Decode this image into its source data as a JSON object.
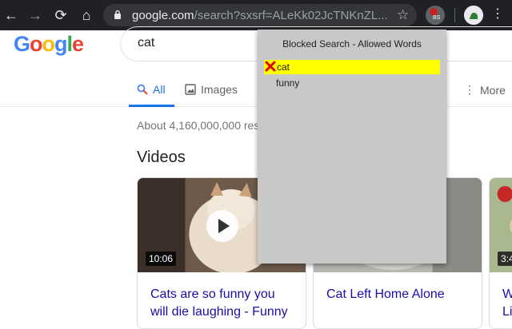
{
  "browser": {
    "url_host": "google.com",
    "url_rest": "/search?sxsrf=ALeKk02JcTNKnZL...",
    "extension_badge": "BS"
  },
  "google": {
    "logo_text": "Google",
    "logo_colors": [
      "#4285f4",
      "#ea4335",
      "#fbbc05",
      "#4285f4",
      "#34a853",
      "#ea4335"
    ],
    "query": "cat",
    "tabs": [
      {
        "label": "All",
        "icon": "search-icon"
      },
      {
        "label": "Images",
        "icon": "image-icon"
      },
      {
        "label": "More",
        "icon": "more-vert-icon"
      }
    ],
    "result_stats": "About 4,160,000,000 res",
    "videos_title": "Videos",
    "videos": [
      {
        "duration": "10:06",
        "title_line1": "Cats are so funny you",
        "title_line2": "will die laughing - Funny"
      },
      {
        "title_line1": "Cat Left Home Alone"
      },
      {
        "duration": "3:4",
        "title_line1": "W",
        "title_line2": "Li"
      }
    ]
  },
  "popup": {
    "title": "Blocked Search - Allowed Words",
    "words": [
      {
        "word": "cat",
        "highlighted": true
      },
      {
        "word": "funny",
        "highlighted": false
      }
    ]
  },
  "colors": {
    "accent": "#1a73e8",
    "link": "#1a0dab",
    "highlight": "#ffff00",
    "remove_icon": "#e60000"
  }
}
